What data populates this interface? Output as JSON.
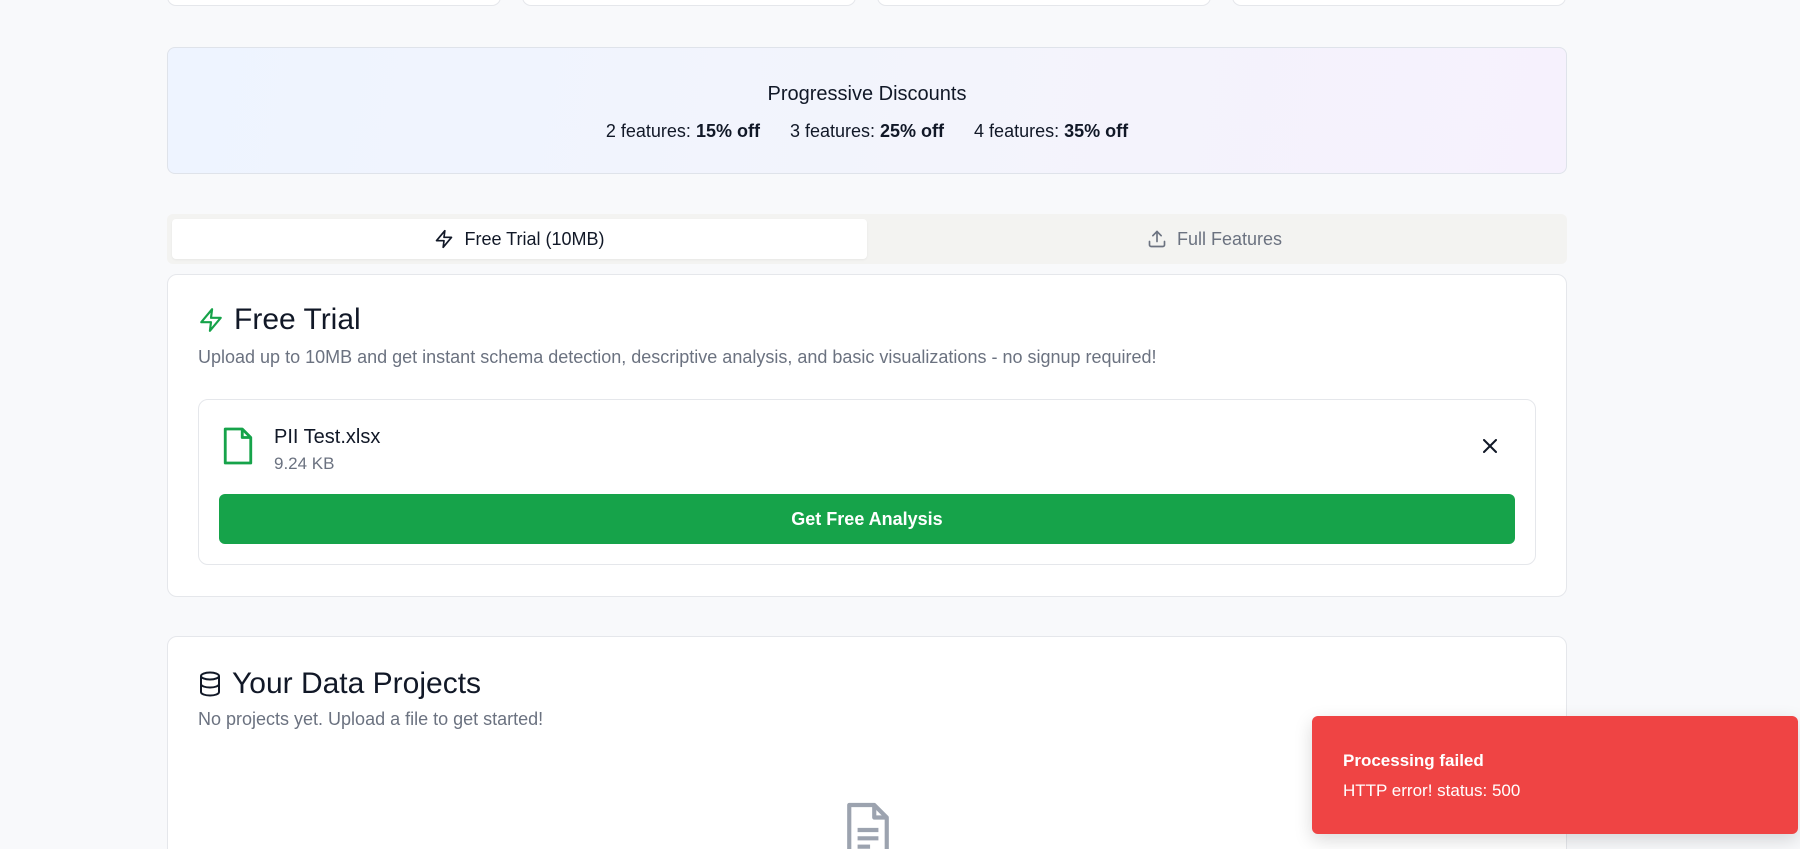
{
  "discounts": {
    "title": "Progressive Discounts",
    "tiers": [
      {
        "label": "2 features:",
        "value": "15% off"
      },
      {
        "label": "3 features:",
        "value": "25% off"
      },
      {
        "label": "4 features:",
        "value": "35% off"
      }
    ]
  },
  "tabs": [
    {
      "label": "Free Trial (10MB)",
      "icon": "zap-icon",
      "active": true
    },
    {
      "label": "Full Features",
      "icon": "upload-icon",
      "active": false
    }
  ],
  "free_trial": {
    "title": "Free Trial",
    "description": "Upload up to 10MB and get instant schema detection, descriptive analysis, and basic visualizations - no signup required!",
    "file": {
      "name": "PII Test.xlsx",
      "size": "9.24 KB"
    },
    "button_label": "Get Free Analysis"
  },
  "projects": {
    "title": "Your Data Projects",
    "description": "No projects yet. Upload a file to get started!"
  },
  "toast": {
    "title": "Processing failed",
    "message": "HTTP error! status: 500"
  },
  "colors": {
    "accent_green": "#16a34a",
    "error_red": "#ef4444"
  }
}
